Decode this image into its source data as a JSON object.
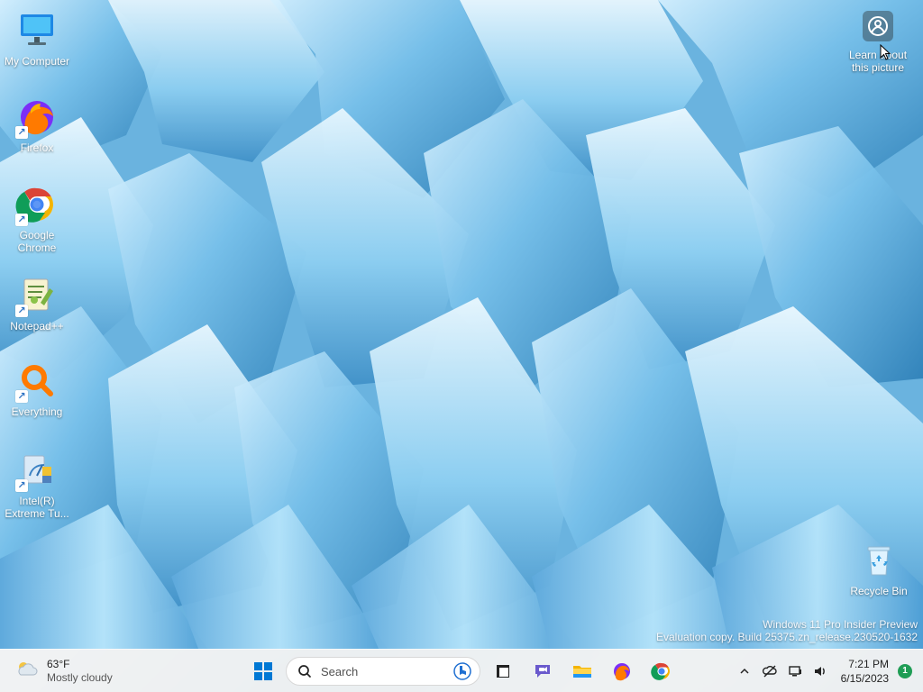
{
  "desktop": {
    "icons": [
      {
        "label": "My Computer"
      },
      {
        "label": "Firefox"
      },
      {
        "label": "Google Chrome"
      },
      {
        "label": "Notepad++"
      },
      {
        "label": "Everything"
      },
      {
        "label": "Intel(R) Extreme Tu..."
      }
    ],
    "learn_picture": "Learn about this picture",
    "recycle_bin": "Recycle Bin",
    "watermark_line1": "Windows 11 Pro Insider Preview",
    "watermark_line2": "Evaluation copy. Build 25375.zn_release.230520-1632"
  },
  "taskbar": {
    "weather": {
      "temperature": "63°F",
      "condition": "Mostly cloudy",
      "icon": "cloudy-weather-icon"
    },
    "search_label": "Search",
    "pinned": [
      {
        "name": "start",
        "icon": "windows-start-icon"
      },
      {
        "name": "search",
        "icon": "search-icon"
      },
      {
        "name": "task-view",
        "icon": "task-view-icon"
      },
      {
        "name": "chat",
        "icon": "chat-icon"
      },
      {
        "name": "file-explorer",
        "icon": "folder-icon"
      },
      {
        "name": "firefox",
        "icon": "firefox-icon"
      },
      {
        "name": "chrome",
        "icon": "chrome-icon"
      }
    ],
    "tray": {
      "time": "7:21 PM",
      "date": "6/15/2023",
      "notifications": "1"
    }
  },
  "colors": {
    "taskbar": "#f2f2f2",
    "accent_blue": "#0078d4",
    "notification_green": "#1f9d55"
  }
}
